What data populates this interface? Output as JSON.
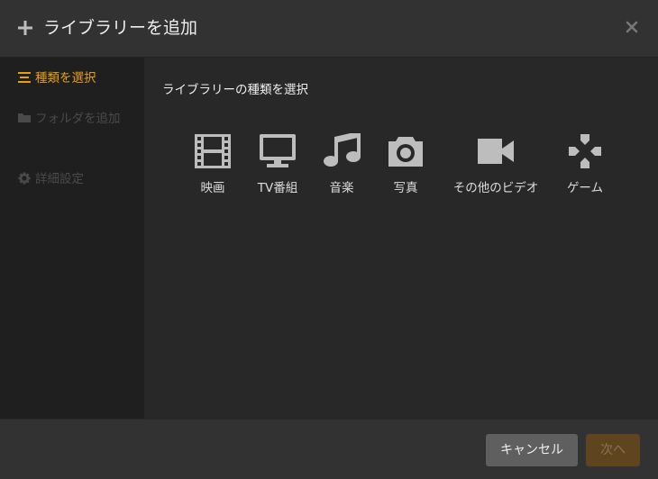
{
  "header": {
    "title": "ライブラリーを追加",
    "plus_icon": "plus-icon",
    "close_icon": "close-icon"
  },
  "sidebar": {
    "items": [
      {
        "label": "種類を選択",
        "icon": "list-icon",
        "state": "active"
      },
      {
        "label": "フォルダを追加",
        "icon": "folder-icon",
        "state": "disabled"
      },
      {
        "label": "詳細設定",
        "icon": "gear-icon",
        "state": "disabled"
      }
    ]
  },
  "main": {
    "heading": "ライブラリーの種類を選択",
    "types": [
      {
        "label": "映画",
        "icon": "film-icon"
      },
      {
        "label": "TV番組",
        "icon": "tv-icon"
      },
      {
        "label": "音楽",
        "icon": "music-note-icon"
      },
      {
        "label": "写真",
        "icon": "camera-icon"
      },
      {
        "label": "その他のビデオ",
        "icon": "video-camera-icon"
      },
      {
        "label": "ゲーム",
        "icon": "gamepad-icon"
      }
    ]
  },
  "footer": {
    "cancel_label": "キャンセル",
    "next_label": "次へ"
  },
  "colors": {
    "accent": "#e5a00d",
    "icon": "#bdbdbd",
    "disabled": "#4a4a4a"
  }
}
